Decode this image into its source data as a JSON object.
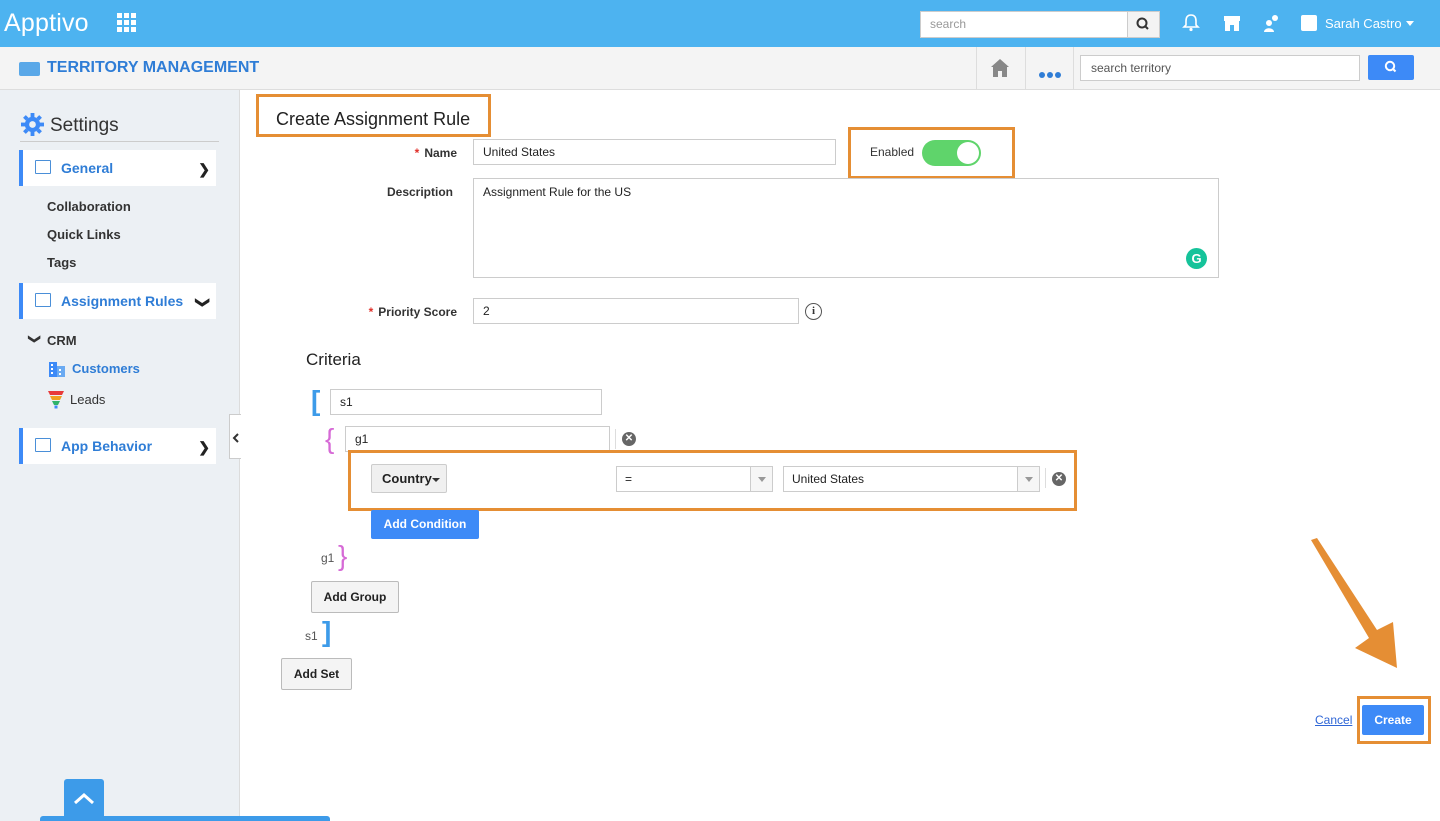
{
  "topbar": {
    "logo": "Apptivo",
    "search_placeholder": "search",
    "user_name": "Sarah Castro"
  },
  "appbar": {
    "title": "TERRITORY MANAGEMENT",
    "search_placeholder": "search territory"
  },
  "sidebar": {
    "title": "Settings",
    "general": "General",
    "general_items": [
      "Collaboration",
      "Quick Links",
      "Tags"
    ],
    "assignment_rules": "Assignment Rules",
    "crm": "CRM",
    "customers": "Customers",
    "leads": "Leads",
    "app_behavior": "App Behavior"
  },
  "form": {
    "title": "Create Assignment Rule",
    "name_label": "Name",
    "name_value": "United States",
    "enabled_label": "Enabled",
    "enabled": true,
    "description_label": "Description",
    "description_value": "Assignment Rule for the US",
    "priority_label": "Priority Score",
    "priority_value": "2",
    "criteria_title": "Criteria",
    "set_name": "s1",
    "group_name": "g1",
    "condition": {
      "field": "Country",
      "operator": "=",
      "value": "United States"
    },
    "add_condition": "Add Condition",
    "add_group": "Add Group",
    "add_set": "Add Set",
    "group_close_label": "g1",
    "set_close_label": "s1",
    "cancel": "Cancel",
    "create": "Create"
  },
  "colors": {
    "accent": "#3d8af7",
    "highlight": "#e58e34",
    "toggle_on": "#5fd46b",
    "set_bracket": "#3d9be9",
    "group_bracket": "#d66ad6"
  }
}
